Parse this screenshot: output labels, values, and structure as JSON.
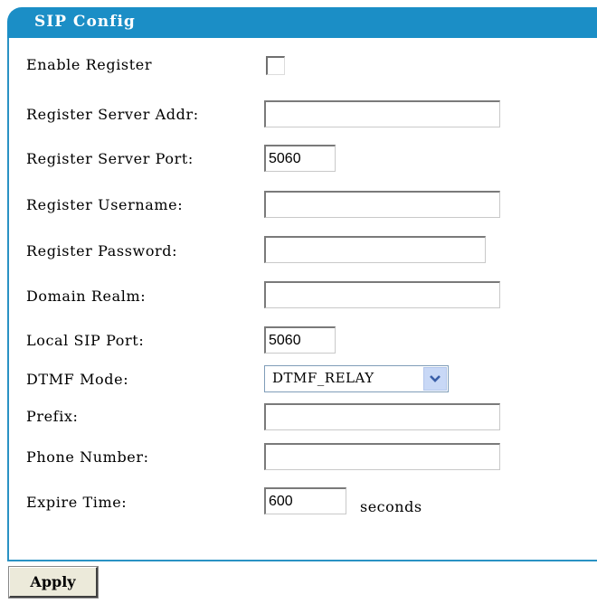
{
  "panel": {
    "title": "SIP Config"
  },
  "fields": {
    "enable_register": {
      "label": "Enable Register",
      "checked": false
    },
    "server_addr": {
      "label": "Register Server Addr:",
      "value": ""
    },
    "server_port": {
      "label": "Register Server Port:",
      "value": "5060"
    },
    "username": {
      "label": "Register Username:",
      "value": ""
    },
    "password": {
      "label": "Register Password:",
      "value": ""
    },
    "domain_realm": {
      "label": "Domain Realm:",
      "value": ""
    },
    "local_sip_port": {
      "label": "Local SIP Port:",
      "value": "5060"
    },
    "dtmf_mode": {
      "label": "DTMF Mode:",
      "value": "DTMF_RELAY"
    },
    "prefix": {
      "label": "Prefix:",
      "value": ""
    },
    "phone_number": {
      "label": "Phone Number:",
      "value": ""
    },
    "expire_time": {
      "label": "Expire Time:",
      "value": "600",
      "unit": "seconds"
    }
  },
  "actions": {
    "apply_label": "Apply"
  },
  "colors": {
    "accent": "#1b8ec6",
    "button_bg": "#eceada",
    "select_button": "#c8d8f6"
  }
}
